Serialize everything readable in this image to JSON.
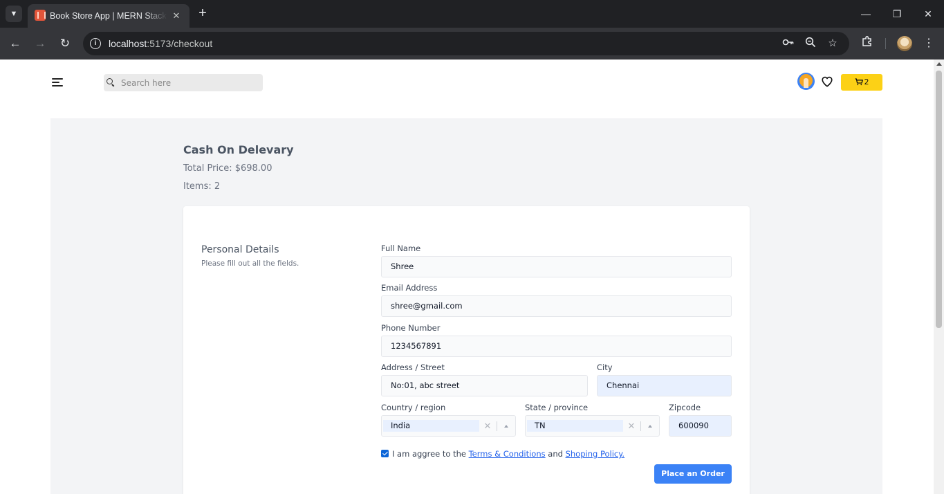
{
  "browser": {
    "tab_title": "Book Store App | MERN Stack Project",
    "tab_close": "✕",
    "new_tab": "+",
    "url_host": "localhost",
    "url_path": ":5173/checkout",
    "icons": [
      "tab-list-icon",
      "favicon-icon",
      "back-icon",
      "forward-icon",
      "reload-icon",
      "site-info-icon",
      "password-key-icon",
      "zoom-icon",
      "bookmark-star-icon",
      "extensions-icon",
      "profile-avatar",
      "more-menu-icon",
      "minimize-icon",
      "maximize-icon",
      "window-close-icon"
    ]
  },
  "header": {
    "search_placeholder": "Search here",
    "cart_count": "2"
  },
  "checkout": {
    "title": "Cash On Delevary",
    "total_price": "Total Price: $698.00",
    "items": "Items: 2"
  },
  "form": {
    "section_title": "Personal Details",
    "section_subtitle": "Please fill out all the fields.",
    "full_name_label": "Full Name",
    "full_name_value": "Shree",
    "email_label": "Email Address",
    "email_value": "shree@gmail.com",
    "phone_label": "Phone Number",
    "phone_value": "1234567891",
    "address_label": "Address / Street",
    "address_value": "No:01, abc street",
    "city_label": "City",
    "city_value": "Chennai",
    "country_label": "Country / region",
    "country_value": "India",
    "state_label": "State / province",
    "state_value": "TN",
    "zipcode_label": "Zipcode",
    "zipcode_value": "600090",
    "agree_prefix": "I am aggree to the ",
    "terms_link": "Terms & Conditions",
    "agree_and": " and ",
    "policy_link": "Shoping Policy.",
    "agree_checked": true,
    "submit_label": "Place an Order"
  },
  "colors": {
    "cart_button": "#fcd116",
    "primary_button": "#3b82f6",
    "panel_background": "#f3f4f6",
    "autofill_background": "#e8f0fe"
  }
}
